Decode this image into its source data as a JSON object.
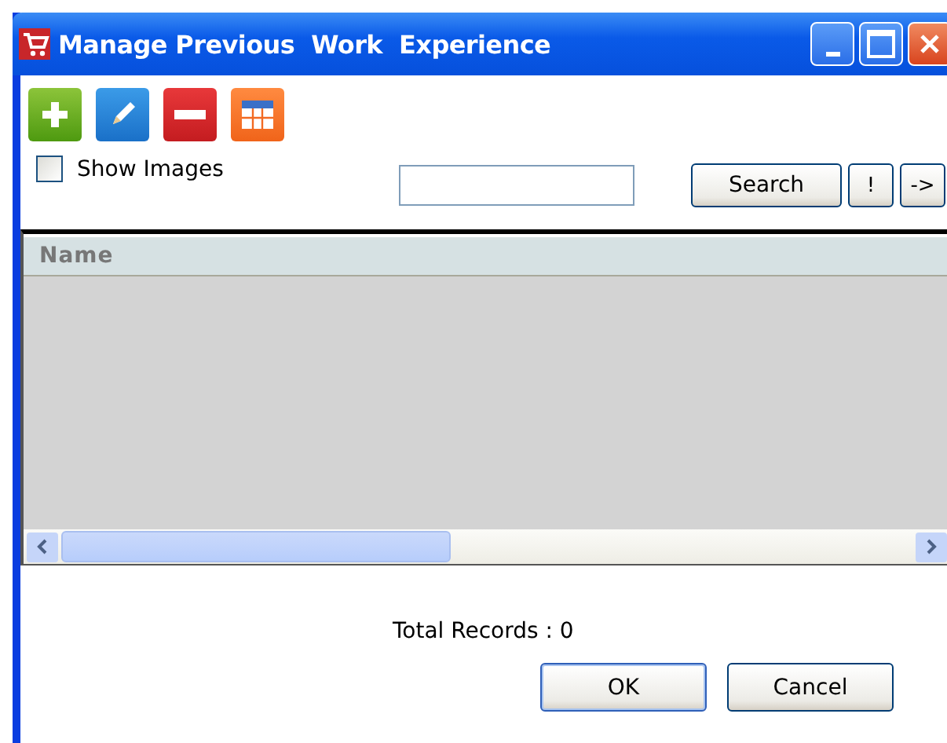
{
  "window": {
    "title": "Manage Previous  Work  Experience"
  },
  "toolbar": [
    {
      "kind": "add"
    },
    {
      "kind": "edit"
    },
    {
      "kind": "delete"
    },
    {
      "kind": "grid"
    }
  ],
  "show_images": {
    "label": "Show Images",
    "checked": false
  },
  "search": {
    "button": "Search",
    "buttons": [
      "!",
      "->"
    ]
  },
  "table": {
    "columns": [
      "Name"
    ]
  },
  "status": "Total Records : 0",
  "buttons": [
    "OK",
    "Cancel"
  ]
}
